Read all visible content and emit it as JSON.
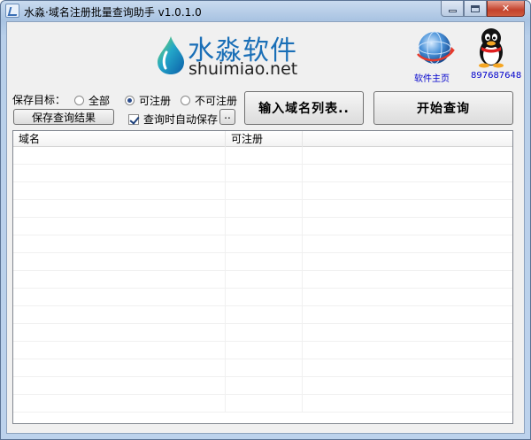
{
  "window": {
    "title": "水淼·域名注册批量查询助手 v1.0.1.0"
  },
  "header": {
    "logo_cn": "水淼软件",
    "logo_en": "shuimiao.net",
    "homepage_label": "软件主页",
    "qq_label": "897687648"
  },
  "controls": {
    "save_target_label": "保存目标：",
    "radio_options": [
      {
        "label": "全部",
        "selected": false
      },
      {
        "label": "可注册",
        "selected": true
      },
      {
        "label": "不可注册",
        "selected": false
      }
    ],
    "save_results_button": "保存查询结果",
    "auto_save_label": "查询时自动保存",
    "auto_save_checked": true,
    "browse_button": "..",
    "import_button": "输入域名列表..",
    "start_button": "开始查询"
  },
  "table": {
    "columns": [
      "域名",
      "可注册",
      ""
    ],
    "rows": []
  },
  "colors": {
    "logo_blue": "#1a6fb7",
    "link_blue": "#0000cc",
    "client_bg": "#f0f0f0"
  }
}
